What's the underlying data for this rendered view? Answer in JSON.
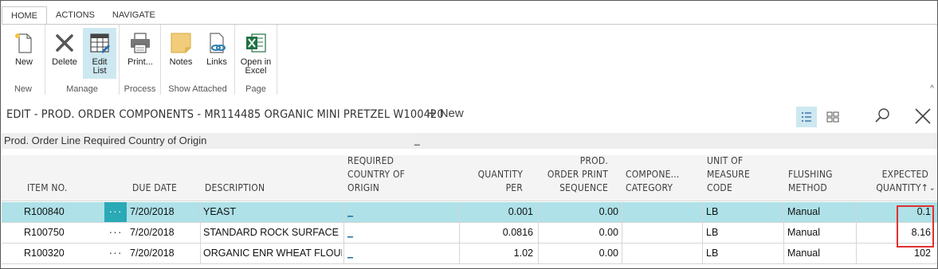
{
  "ribbon": {
    "tabs": [
      "HOME",
      "ACTIONS",
      "NAVIGATE"
    ],
    "groups": {
      "new": {
        "label": "New",
        "new_btn": "New"
      },
      "manage": {
        "label": "Manage",
        "delete_btn": "Delete",
        "edit_list_btn_1": "Edit",
        "edit_list_btn_2": "List"
      },
      "process": {
        "label": "Process",
        "print_btn": "Print..."
      },
      "show_attached": {
        "label": "Show Attached",
        "notes_btn": "Notes",
        "links_btn": "Links"
      },
      "page": {
        "label": "Page",
        "excel_btn_1": "Open in",
        "excel_btn_2": "Excel"
      }
    },
    "collapse_glyph": "^"
  },
  "page": {
    "title": "EDIT - PROD. ORDER COMPONENTS - MR114485 ORGANIC MINI PRETZEL W100420",
    "new_action": "New"
  },
  "filter": {
    "label": "Prod. Order Line Required Country of Origin",
    "value": "_"
  },
  "grid": {
    "headers": {
      "item_no": "ITEM NO.",
      "due_date": "DUE DATE",
      "description": "DESCRIPTION",
      "country_1": "REQUIRED",
      "country_2": "COUNTRY OF",
      "country_3": "ORIGIN",
      "qty_per_1": "QUANTITY",
      "qty_per_2": "PER",
      "print_seq_1": "PROD.",
      "print_seq_2": "ORDER PRINT",
      "print_seq_3": "SEQUENCE",
      "category_1": "COMPONE...",
      "category_2": "CATEGORY",
      "uom_1": "UNIT OF",
      "uom_2": "MEASURE",
      "uom_3": "CODE",
      "flushing_1": "FLUSHING",
      "flushing_2": "METHOD",
      "expected_1": "EXPECTED",
      "expected_2": "QUANTITY↑"
    },
    "rows": [
      {
        "item_no": "R100840",
        "dots": "···",
        "due_date": "7/20/2018",
        "description": "YEAST",
        "country": "_",
        "qty_per": "0.001",
        "print_seq": "0.00",
        "category": "",
        "uom": "LB",
        "flushing": "Manual",
        "expected": "0.1"
      },
      {
        "item_no": "R100750",
        "dots": "···",
        "due_date": "7/20/2018",
        "description": "STANDARD ROCK SURFACE S",
        "country": "_",
        "qty_per": "0.0816",
        "print_seq": "0.00",
        "category": "",
        "uom": "LB",
        "flushing": "Manual",
        "expected": "8.16"
      },
      {
        "item_no": "R100320",
        "dots": "···",
        "due_date": "7/20/2018",
        "description": "ORGANIC ENR WHEAT FLOUR",
        "country": "_",
        "qty_per": "1.02",
        "print_seq": "0.00",
        "category": "",
        "uom": "LB",
        "flushing": "Manual",
        "expected": "102"
      }
    ]
  },
  "colors": {
    "selected_row": "#aee1e8",
    "selected_dots": "#2aa9b6",
    "highlight_box": "#e03030"
  }
}
